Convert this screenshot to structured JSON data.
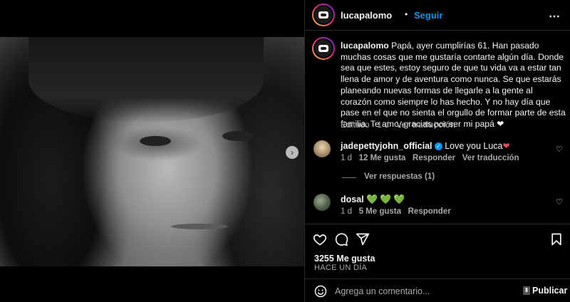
{
  "post": {
    "username": "lucapalomo",
    "separator": "•",
    "follow_label": "Seguir",
    "more_icon": "more-horizontal-icon",
    "caption_text": "Papá, ayer cumplirías 61. Han pasado muchas cosas que me gustaría contarte algún día. Donde sea que estes, estoy seguro de que tu vida va a estar tan llena de amor y de aventura como nunca. Se que estarás planeando nuevas formas de llegarle a la gente al corazón como siempre lo has hecho. Y no hay día que pase en el que no sienta el orgullo de formar parte de esta familia. Te amo, gracias por ser mi papá",
    "caption_heart": "❤",
    "caption_meta": {
      "edited": "Editado",
      "dot": "·",
      "age": "1 d",
      "translate": "Ver traducción"
    }
  },
  "media": {
    "next_icon": "chevron-right-icon",
    "carousel_count": 3,
    "carousel_active": 0
  },
  "comments": [
    {
      "username": "jadepettyjohn_official",
      "verified": true,
      "text": "Love you Luca",
      "emoji": "❤",
      "age": "1 d",
      "likes": "12 Me gusta",
      "reply": "Responder",
      "translate": "Ver traducción",
      "view_replies": "Ver respuestas (1)"
    },
    {
      "username": "dosal",
      "verified": false,
      "text": "",
      "emoji": "💚💚💚",
      "age": "1 d",
      "likes": "5 Me gusta",
      "reply": "Responder"
    }
  ],
  "actions": {
    "like_icon": "heart-icon",
    "comment_icon": "comment-icon",
    "share_icon": "share-icon",
    "save_icon": "bookmark-icon"
  },
  "likes_label": "3255 Me gusta",
  "time_label": "HACE UN DÍA",
  "composer": {
    "placeholder": "Agrega un comentario...",
    "emoji_icon": "emoji-icon",
    "post_label": "Publicar"
  },
  "colors": {
    "background": "#000000",
    "accent_blue": "#0095f6",
    "secondary_text": "#a8a8a8",
    "divider": "#262626"
  }
}
